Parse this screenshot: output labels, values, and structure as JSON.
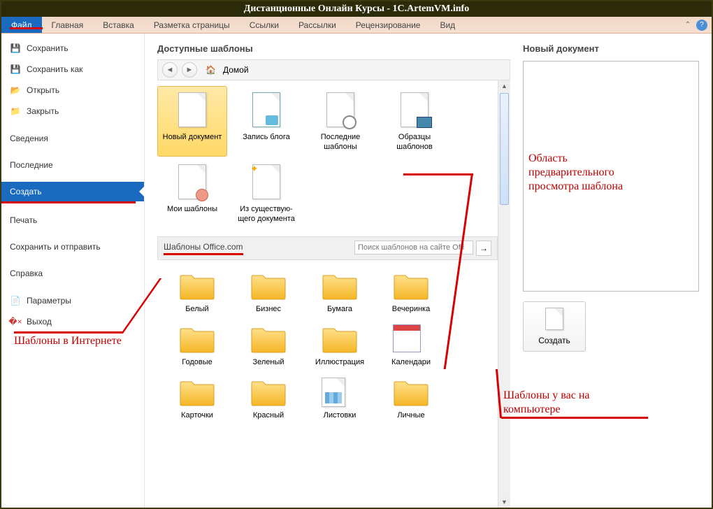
{
  "window_title": "Дистанционные Онлайн Курсы - 1C.ArtemVM.info",
  "ribbon": {
    "tabs": [
      "Файл",
      "Главная",
      "Вставка",
      "Разметка страницы",
      "Ссылки",
      "Рассылки",
      "Рецензирование",
      "Вид"
    ]
  },
  "sidebar": {
    "save": "Сохранить",
    "save_as": "Сохранить как",
    "open": "Открыть",
    "close": "Закрыть",
    "info": "Сведения",
    "recent": "Последние",
    "new": "Создать",
    "print": "Печать",
    "save_send": "Сохранить и отправить",
    "help": "Справка",
    "options": "Параметры",
    "exit": "Выход"
  },
  "templates": {
    "heading": "Доступные шаблоны",
    "home": "Домой",
    "items": {
      "blank": "Новый документ",
      "blog": "Запись блога",
      "recent": "Последние шаблоны",
      "samples": "Образцы шаблонов",
      "my": "Мои шаблоны",
      "existing": "Из существую-\nщего документа"
    },
    "office_section": "Шаблоны Office.com",
    "search_placeholder": "Поиск шаблонов на сайте Offi",
    "folders": [
      "Белый",
      "Бизнес",
      "Бумага",
      "Вечеринка",
      "Годовые",
      "Зеленый",
      "Иллюстрация",
      "Календари",
      "Карточки",
      "Красный",
      "Листовки",
      "Личные"
    ]
  },
  "preview": {
    "heading": "Новый документ",
    "create_btn": "Создать"
  },
  "annotations": {
    "internet": "Шаблоны в Интернете",
    "preview": "Область\nпредварительного\nпросмотра шаблона",
    "local": "Шаблоны у вас на\nкомпьютере"
  }
}
